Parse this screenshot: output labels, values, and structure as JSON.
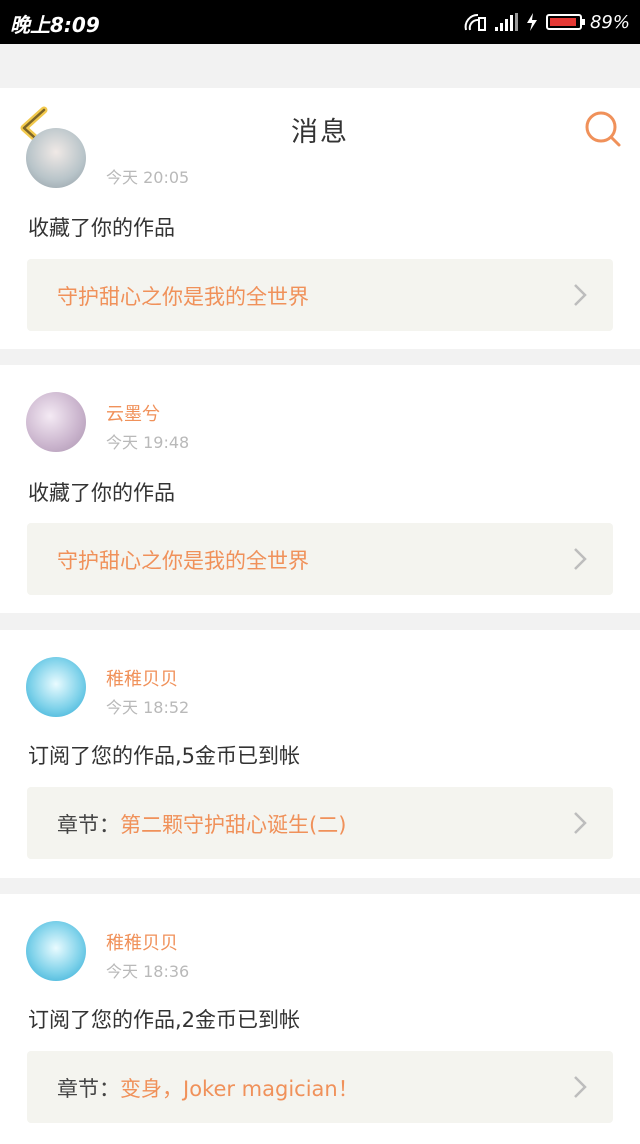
{
  "status_bar": {
    "time": "晚上8:09",
    "battery": "89%"
  },
  "header": {
    "title": "消息"
  },
  "notifications": [
    {
      "name": "",
      "time": "今天 20:05",
      "action": "收藏了你的作品",
      "link_prefix": "",
      "link_text": "守护甜心之你是我的全世界"
    },
    {
      "name": "云墨兮",
      "time": "今天 19:48",
      "action": "收藏了你的作品",
      "link_prefix": "",
      "link_text": "守护甜心之你是我的全世界"
    },
    {
      "name": "稚稚贝贝",
      "time": "今天 18:52",
      "action": "订阅了您的作品,5金币已到帐",
      "link_prefix": "章节：",
      "link_text": "第二颗守护甜心诞生(二)"
    },
    {
      "name": "稚稚贝贝",
      "time": "今天 18:36",
      "action": "订阅了您的作品,2金币已到帐",
      "link_prefix": "章节：",
      "link_text": "变身，Joker magician！"
    }
  ]
}
